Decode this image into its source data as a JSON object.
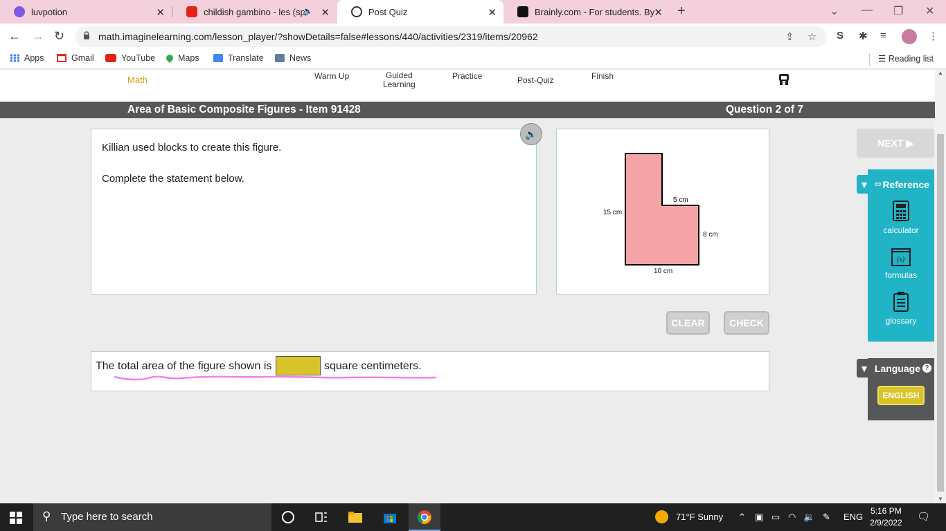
{
  "browser": {
    "tabs": [
      {
        "label": "luvpotion",
        "active": false
      },
      {
        "label": "childish gambino - les (sped",
        "active": false
      },
      {
        "label": "Post Quiz",
        "active": true
      },
      {
        "label": "Brainly.com - For students. By stu",
        "active": false
      }
    ],
    "url": "math.imaginelearning.com/lesson_player/?showDetails=false#lessons/440/activities/2319/items/20962",
    "bookmarks": [
      "Apps",
      "Gmail",
      "YouTube",
      "Maps",
      "Translate",
      "News"
    ],
    "reading_list": "Reading list"
  },
  "lesson": {
    "brand": "Math",
    "steps": [
      {
        "label": "Warm Up"
      },
      {
        "label": "Guided\nLearning"
      },
      {
        "label": "Practice"
      },
      {
        "label": "Post-Quiz"
      },
      {
        "label": "Finish"
      }
    ],
    "title": "Area of Basic Composite Figures - Item 91428",
    "question_counter": "Question 2 of 7"
  },
  "question": {
    "line1": "Killian used blocks to create this figure.",
    "line2": "Complete the statement below."
  },
  "figure": {
    "fill": "#f4a3a6",
    "labels": {
      "left": "15 cm",
      "top": "5 cm",
      "right": "8 cm",
      "bottom": "10 cm"
    }
  },
  "buttons": {
    "clear": "CLEAR",
    "check": "CHECK",
    "next": "NEXT ▶"
  },
  "answer": {
    "before": "The total area of the figure shown is",
    "after": "square centimeters.",
    "value": ""
  },
  "sidebar": {
    "reference_title": "Reference",
    "items": [
      {
        "label": "calculator",
        "icon": "calculator-icon"
      },
      {
        "label": "formulas",
        "icon": "formulas-icon"
      },
      {
        "label": "glossary",
        "icon": "glossary-icon"
      }
    ],
    "language_title": "Language",
    "language_button": "ENGLISH"
  },
  "taskbar": {
    "search_placeholder": "Type here to search",
    "weather": "71°F  Sunny",
    "lang": "ENG",
    "time": "5:16 PM",
    "date": "2/9/2022"
  },
  "colors": {
    "accent": "#21b3c6",
    "answer_box": "#d9c32a",
    "title_bar": "#555759"
  }
}
